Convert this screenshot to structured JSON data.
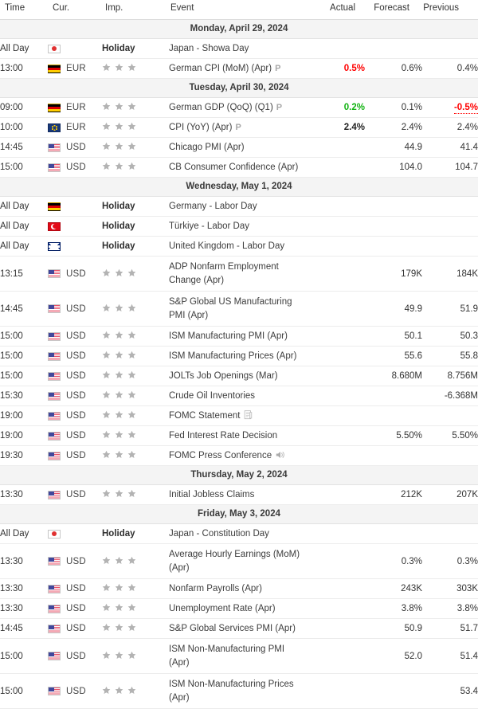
{
  "header": {
    "time": "Time",
    "currency": "Cur.",
    "importance": "Imp.",
    "event": "Event",
    "actual": "Actual",
    "forecast": "Forecast",
    "previous": "Previous"
  },
  "labels": {
    "all_day": "All Day",
    "holiday": "Holiday"
  },
  "colors": {
    "up": "#12b312",
    "down": "#ff0000",
    "neutral": "#333333",
    "day_header_bg": "#f4f4f4",
    "star": "#b3b3b3"
  },
  "groups": [
    {
      "date": "Monday, April 29, 2024",
      "rows": [
        {
          "time": "All Day",
          "currency": "",
          "flag": "jp",
          "importance": "holiday",
          "event": "Japan - Showa Day",
          "marker": "",
          "icon": "",
          "actual": "",
          "actual_state": "none",
          "forecast": "",
          "previous": "",
          "previous_state": "none",
          "tall": false
        },
        {
          "time": "13:00",
          "currency": "EUR",
          "flag": "de",
          "importance": "3",
          "event": "German CPI (MoM) (Apr)",
          "marker": "P",
          "icon": "",
          "actual": "0.5%",
          "actual_state": "down",
          "forecast": "0.6%",
          "previous": "0.4%",
          "previous_state": "none",
          "tall": false
        }
      ]
    },
    {
      "date": "Tuesday, April 30, 2024",
      "rows": [
        {
          "time": "09:00",
          "currency": "EUR",
          "flag": "de",
          "importance": "3",
          "event": "German GDP (QoQ) (Q1)",
          "marker": "P",
          "icon": "",
          "actual": "0.2%",
          "actual_state": "up",
          "forecast": "0.1%",
          "previous": "-0.5%",
          "previous_state": "dotted-down",
          "tall": false
        },
        {
          "time": "10:00",
          "currency": "EUR",
          "flag": "eu",
          "importance": "3",
          "event": "CPI (YoY) (Apr)",
          "marker": "P",
          "icon": "",
          "actual": "2.4%",
          "actual_state": "bold",
          "forecast": "2.4%",
          "previous": "2.4%",
          "previous_state": "none",
          "tall": false
        },
        {
          "time": "14:45",
          "currency": "USD",
          "flag": "us",
          "importance": "3",
          "event": "Chicago PMI (Apr)",
          "marker": "",
          "icon": "",
          "actual": "",
          "actual_state": "none",
          "forecast": "44.9",
          "previous": "41.4",
          "previous_state": "none",
          "tall": false
        },
        {
          "time": "15:00",
          "currency": "USD",
          "flag": "us",
          "importance": "3",
          "event": "CB Consumer Confidence (Apr)",
          "marker": "",
          "icon": "",
          "actual": "",
          "actual_state": "none",
          "forecast": "104.0",
          "previous": "104.7",
          "previous_state": "none",
          "tall": false
        }
      ]
    },
    {
      "date": "Wednesday, May 1, 2024",
      "rows": [
        {
          "time": "All Day",
          "currency": "",
          "flag": "de",
          "importance": "holiday",
          "event": "Germany - Labor Day",
          "marker": "",
          "icon": "",
          "actual": "",
          "actual_state": "none",
          "forecast": "",
          "previous": "",
          "previous_state": "none",
          "tall": false
        },
        {
          "time": "All Day",
          "currency": "",
          "flag": "tr",
          "importance": "holiday",
          "event": "Türkiye - Labor Day",
          "marker": "",
          "icon": "",
          "actual": "",
          "actual_state": "none",
          "forecast": "",
          "previous": "",
          "previous_state": "none",
          "tall": false
        },
        {
          "time": "All Day",
          "currency": "",
          "flag": "gb",
          "importance": "holiday",
          "event": "United Kingdom - Labor Day",
          "marker": "",
          "icon": "",
          "actual": "",
          "actual_state": "none",
          "forecast": "",
          "previous": "",
          "previous_state": "none",
          "tall": false
        },
        {
          "time": "13:15",
          "currency": "USD",
          "flag": "us",
          "importance": "3",
          "event": "ADP Nonfarm Employment Change (Apr)",
          "marker": "",
          "icon": "",
          "actual": "",
          "actual_state": "none",
          "forecast": "179K",
          "previous": "184K",
          "previous_state": "none",
          "tall": true
        },
        {
          "time": "14:45",
          "currency": "USD",
          "flag": "us",
          "importance": "3",
          "event": "S&P Global US Manufacturing PMI (Apr)",
          "marker": "",
          "icon": "",
          "actual": "",
          "actual_state": "none",
          "forecast": "49.9",
          "previous": "51.9",
          "previous_state": "none",
          "tall": true
        },
        {
          "time": "15:00",
          "currency": "USD",
          "flag": "us",
          "importance": "3",
          "event": "ISM Manufacturing PMI (Apr)",
          "marker": "",
          "icon": "",
          "actual": "",
          "actual_state": "none",
          "forecast": "50.1",
          "previous": "50.3",
          "previous_state": "none",
          "tall": false
        },
        {
          "time": "15:00",
          "currency": "USD",
          "flag": "us",
          "importance": "3",
          "event": "ISM Manufacturing Prices (Apr)",
          "marker": "",
          "icon": "",
          "actual": "",
          "actual_state": "none",
          "forecast": "55.6",
          "previous": "55.8",
          "previous_state": "none",
          "tall": false
        },
        {
          "time": "15:00",
          "currency": "USD",
          "flag": "us",
          "importance": "3",
          "event": "JOLTs Job Openings (Mar)",
          "marker": "",
          "icon": "",
          "actual": "",
          "actual_state": "none",
          "forecast": "8.680M",
          "previous": "8.756M",
          "previous_state": "none",
          "tall": false
        },
        {
          "time": "15:30",
          "currency": "USD",
          "flag": "us",
          "importance": "3",
          "event": "Crude Oil Inventories",
          "marker": "",
          "icon": "",
          "actual": "",
          "actual_state": "none",
          "forecast": "",
          "previous": "-6.368M",
          "previous_state": "none",
          "tall": false
        },
        {
          "time": "19:00",
          "currency": "USD",
          "flag": "us",
          "importance": "3",
          "event": "FOMC Statement",
          "marker": "",
          "icon": "document-icon",
          "actual": "",
          "actual_state": "none",
          "forecast": "",
          "previous": "",
          "previous_state": "none",
          "tall": false
        },
        {
          "time": "19:00",
          "currency": "USD",
          "flag": "us",
          "importance": "3",
          "event": "Fed Interest Rate Decision",
          "marker": "",
          "icon": "",
          "actual": "",
          "actual_state": "none",
          "forecast": "5.50%",
          "previous": "5.50%",
          "previous_state": "none",
          "tall": false
        },
        {
          "time": "19:30",
          "currency": "USD",
          "flag": "us",
          "importance": "3",
          "event": "FOMC Press Conference",
          "marker": "",
          "icon": "audio-icon",
          "actual": "",
          "actual_state": "none",
          "forecast": "",
          "previous": "",
          "previous_state": "none",
          "tall": false
        }
      ]
    },
    {
      "date": "Thursday, May 2, 2024",
      "rows": [
        {
          "time": "13:30",
          "currency": "USD",
          "flag": "us",
          "importance": "3",
          "event": "Initial Jobless Claims",
          "marker": "",
          "icon": "",
          "actual": "",
          "actual_state": "none",
          "forecast": "212K",
          "previous": "207K",
          "previous_state": "none",
          "tall": false
        }
      ]
    },
    {
      "date": "Friday, May 3, 2024",
      "rows": [
        {
          "time": "All Day",
          "currency": "",
          "flag": "jp",
          "importance": "holiday",
          "event": "Japan - Constitution Day",
          "marker": "",
          "icon": "",
          "actual": "",
          "actual_state": "none",
          "forecast": "",
          "previous": "",
          "previous_state": "none",
          "tall": false
        },
        {
          "time": "13:30",
          "currency": "USD",
          "flag": "us",
          "importance": "3",
          "event": "Average Hourly Earnings (MoM) (Apr)",
          "marker": "",
          "icon": "",
          "actual": "",
          "actual_state": "none",
          "forecast": "0.3%",
          "previous": "0.3%",
          "previous_state": "none",
          "tall": true
        },
        {
          "time": "13:30",
          "currency": "USD",
          "flag": "us",
          "importance": "3",
          "event": "Nonfarm Payrolls (Apr)",
          "marker": "",
          "icon": "",
          "actual": "",
          "actual_state": "none",
          "forecast": "243K",
          "previous": "303K",
          "previous_state": "none",
          "tall": false
        },
        {
          "time": "13:30",
          "currency": "USD",
          "flag": "us",
          "importance": "3",
          "event": "Unemployment Rate (Apr)",
          "marker": "",
          "icon": "",
          "actual": "",
          "actual_state": "none",
          "forecast": "3.8%",
          "previous": "3.8%",
          "previous_state": "none",
          "tall": false
        },
        {
          "time": "14:45",
          "currency": "USD",
          "flag": "us",
          "importance": "3",
          "event": "S&P Global Services PMI (Apr)",
          "marker": "",
          "icon": "",
          "actual": "",
          "actual_state": "none",
          "forecast": "50.9",
          "previous": "51.7",
          "previous_state": "none",
          "tall": false
        },
        {
          "time": "15:00",
          "currency": "USD",
          "flag": "us",
          "importance": "3",
          "event": "ISM Non-Manufacturing PMI (Apr)",
          "marker": "",
          "icon": "",
          "actual": "",
          "actual_state": "none",
          "forecast": "52.0",
          "previous": "51.4",
          "previous_state": "none",
          "tall": true
        },
        {
          "time": "15:00",
          "currency": "USD",
          "flag": "us",
          "importance": "3",
          "event": "ISM Non-Manufacturing Prices (Apr)",
          "marker": "",
          "icon": "",
          "actual": "",
          "actual_state": "none",
          "forecast": "",
          "previous": "53.4",
          "previous_state": "none",
          "tall": true
        }
      ]
    }
  ]
}
